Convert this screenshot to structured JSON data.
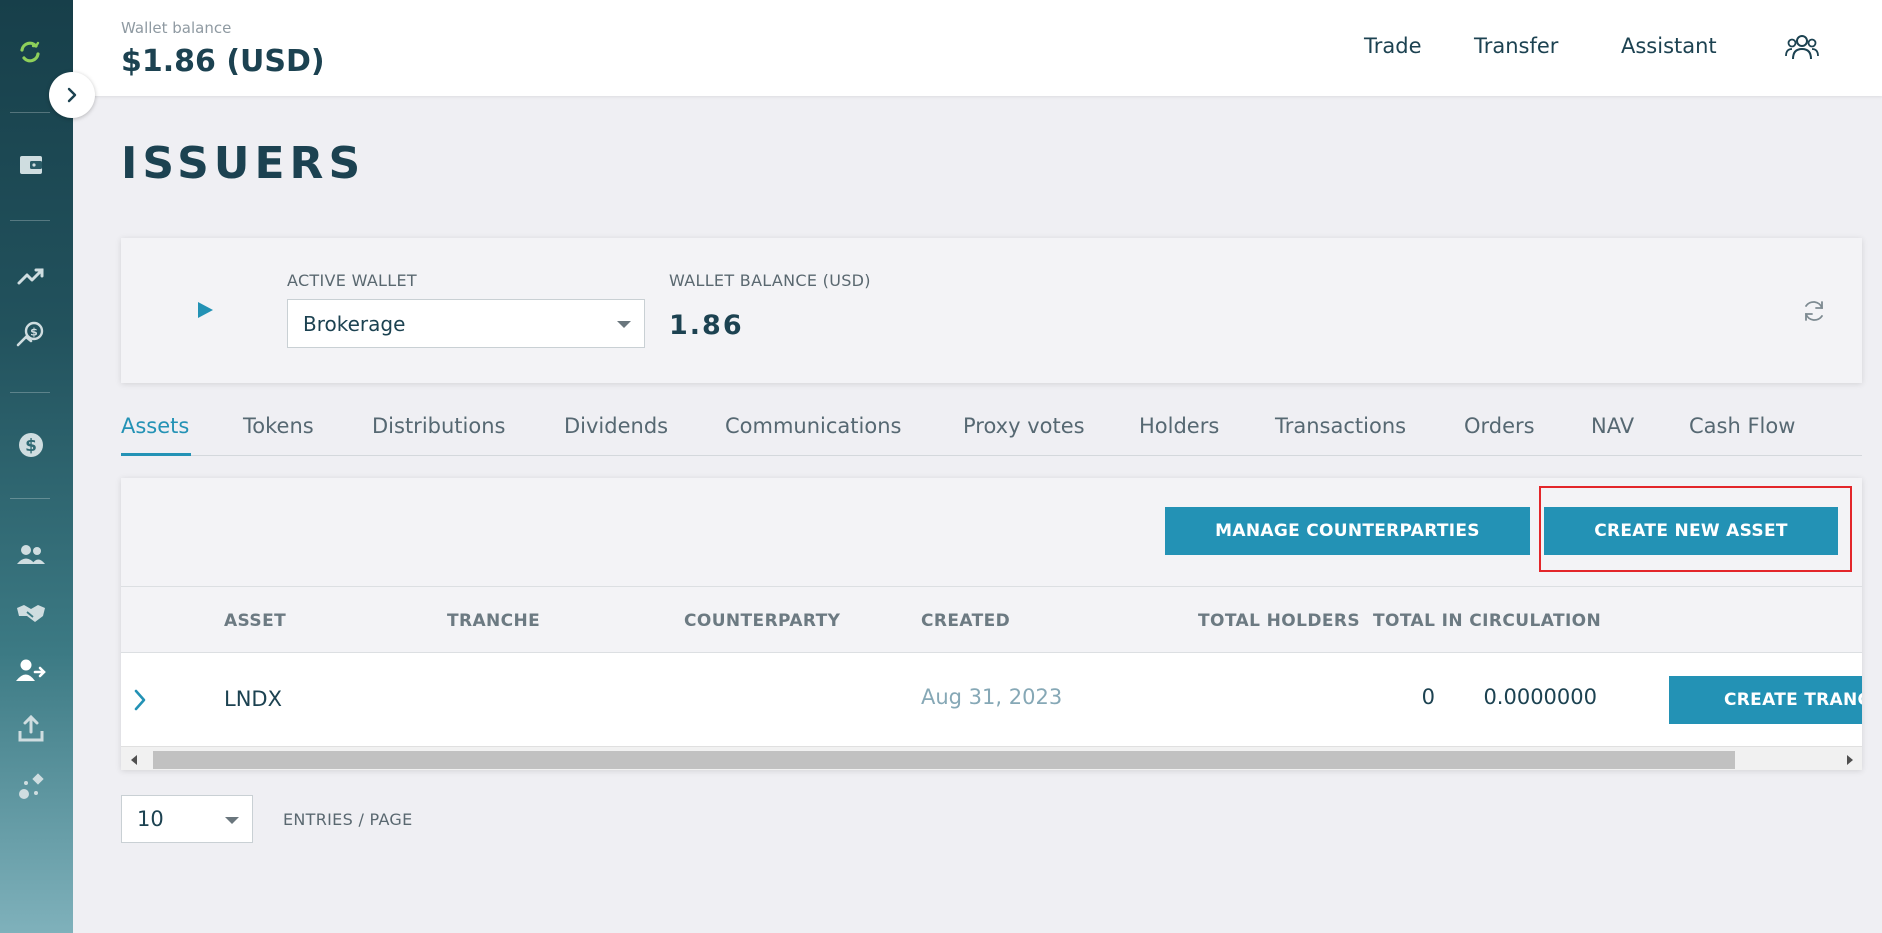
{
  "header": {
    "wallet_balance_label": "Wallet balance",
    "wallet_balance_value": "$1.86 (USD)",
    "nav": [
      "Trade",
      "Transfer",
      "Assistant"
    ]
  },
  "page": {
    "title": "ISSUERS"
  },
  "wallet_card": {
    "active_wallet_label": "ACTIVE WALLET",
    "active_wallet_value": "Brokerage",
    "balance_label": "WALLET BALANCE (USD)",
    "balance_value": "1.86"
  },
  "tabs": [
    "Assets",
    "Tokens",
    "Distributions",
    "Dividends",
    "Communications",
    "Proxy votes",
    "Holders",
    "Transactions",
    "Orders",
    "NAV",
    "Cash Flow"
  ],
  "active_tab": "Assets",
  "actions": {
    "manage_counterparties": "MANAGE COUNTERPARTIES",
    "create_new_asset": "CREATE NEW ASSET"
  },
  "table": {
    "columns": [
      "ASSET",
      "TRANCHE",
      "COUNTERPARTY",
      "CREATED",
      "TOTAL HOLDERS",
      "TOTAL IN CIRCULATION"
    ],
    "rows": [
      {
        "asset": "LNDX",
        "tranche": "",
        "counterparty": "",
        "created": "Aug 31, 2023",
        "total_holders": "0",
        "total_in_circulation": "0.0000000",
        "action": "CREATE TRANC"
      }
    ]
  },
  "pagination": {
    "page_size": "10",
    "label": "ENTRIES / PAGE"
  },
  "colors": {
    "accent": "#2392b5",
    "text_dark": "#1c4251",
    "highlight": "#e3262a"
  },
  "icons": [
    "app-logo-icon",
    "chevron-right-icon",
    "wallet-icon",
    "trending-up-icon",
    "money-hand-icon",
    "dollar-icon",
    "users-icon",
    "handshake-icon",
    "user-transfer-icon",
    "upload-icon",
    "shapes-icon",
    "people-icon",
    "play-icon",
    "refresh-icon"
  ]
}
